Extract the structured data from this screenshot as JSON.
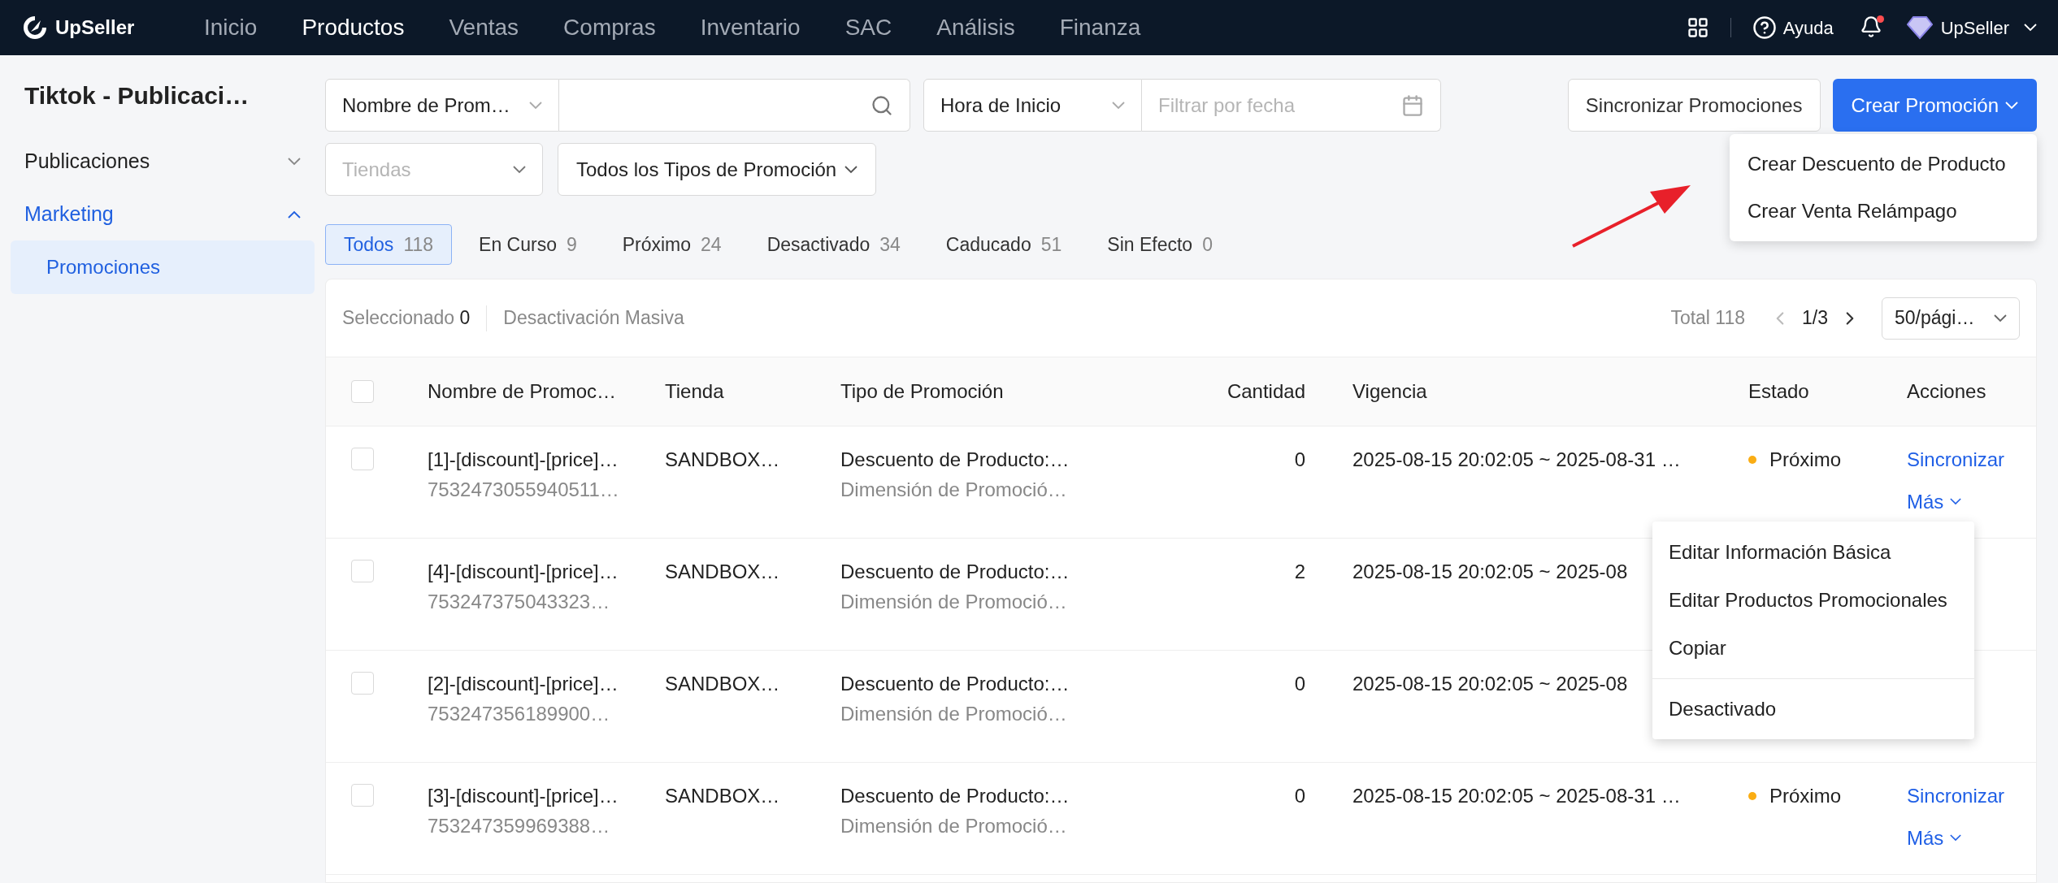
{
  "nav": {
    "brand": "UpSeller",
    "items": [
      {
        "label": "Inicio",
        "selected": false
      },
      {
        "label": "Productos",
        "selected": true
      },
      {
        "label": "Ventas",
        "selected": false
      },
      {
        "label": "Compras",
        "selected": false
      },
      {
        "label": "Inventario",
        "selected": false
      },
      {
        "label": "SAC",
        "selected": false
      },
      {
        "label": "Análisis",
        "selected": false
      },
      {
        "label": "Finanza",
        "selected": false
      }
    ],
    "help": "Ayuda",
    "unread": true,
    "account": "UpSeller"
  },
  "sidebar": {
    "title": "Tiktok - Publicaci…",
    "groups": [
      {
        "label": "Publicaciones",
        "expanded": false,
        "selected": false
      },
      {
        "label": "Marketing",
        "expanded": true,
        "selected": true,
        "children": [
          {
            "label": "Promociones",
            "selected": true
          }
        ]
      }
    ]
  },
  "filters": {
    "search_by": "Nombre de Prom…",
    "time_by": "Hora de Inicio",
    "date_placeholder": "Filtrar por fecha",
    "store_placeholder": "Tiendas",
    "type": "Todos los Tipos de Promoción"
  },
  "buttons": {
    "sync": "Sincronizar Promociones",
    "create": "Crear Promoción"
  },
  "create_menu": [
    "Crear Descuento de Producto",
    "Crear Venta Relámpago"
  ],
  "status_tabs": [
    {
      "label": "Todos",
      "count": "118",
      "selected": true
    },
    {
      "label": "En Curso",
      "count": "9",
      "selected": false
    },
    {
      "label": "Próximo",
      "count": "24",
      "selected": false
    },
    {
      "label": "Desactivado",
      "count": "34",
      "selected": false
    },
    {
      "label": "Caducado",
      "count": "51",
      "selected": false
    },
    {
      "label": "Sin Efecto",
      "count": "0",
      "selected": false
    }
  ],
  "table": {
    "selected_label": "Seleccionado",
    "selected_count": "0",
    "bulk_action": "Desactivación Masiva",
    "total": "Total 118",
    "page": "1/3",
    "page_size": "50/pági…",
    "all_checked": false,
    "columns": [
      "Nombre de Promoc…",
      "Tienda",
      "Tipo de Promoción",
      "Cantidad",
      "Vigencia",
      "Estado",
      "Acciones"
    ],
    "rows": [
      {
        "checked": false,
        "name": "[1]-[discount]-[price]…",
        "id": "7532473055940511…",
        "store": "SANDBOX…",
        "type": "Descuento de Producto:…",
        "dimension": "Dimensión de Promoció…",
        "quantity": "0",
        "period": "2025-08-15 20:02:05 ~ 2025-08-31 …",
        "status": {
          "label": "Próximo",
          "color": "#faad14"
        },
        "actions": [
          "Sincronizar",
          "Más"
        ]
      },
      {
        "checked": false,
        "name": "[4]-[discount]-[price]…",
        "id": "753247375043323…",
        "store": "SANDBOX…",
        "type": "Descuento de Producto:…",
        "dimension": "Dimensión de Promoció…",
        "quantity": "2",
        "period": "2025-08-15 20:02:05 ~ 2025-08"
      },
      {
        "checked": false,
        "name": "[2]-[discount]-[price]…",
        "id": "753247356189900…",
        "store": "SANDBOX…",
        "type": "Descuento de Producto:…",
        "dimension": "Dimensión de Promoció…",
        "quantity": "0",
        "period": "2025-08-15 20:02:05 ~ 2025-08"
      },
      {
        "checked": false,
        "name": "[3]-[discount]-[price]…",
        "id": "753247359969388…",
        "store": "SANDBOX…",
        "type": "Descuento de Producto:…",
        "dimension": "Dimensión de Promoció…",
        "quantity": "0",
        "period": "2025-08-15 20:02:05 ~ 2025-08-31 …",
        "status": {
          "label": "Próximo",
          "color": "#faad14"
        },
        "actions": [
          "Sincronizar",
          "Más"
        ]
      }
    ]
  },
  "row_menu": [
    {
      "label": "Editar Información Básica",
      "divider_before": false
    },
    {
      "label": "Editar Productos Promocionales",
      "divider_before": false
    },
    {
      "label": "Copiar",
      "divider_before": false
    },
    {
      "label": "Desactivado",
      "divider_before": true
    }
  ]
}
